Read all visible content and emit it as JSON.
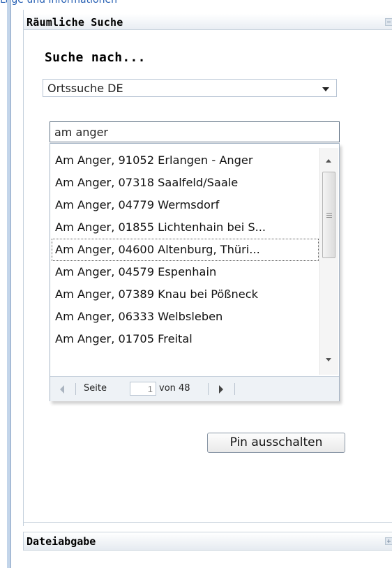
{
  "top_link": "Lage und Informationen",
  "spatial_panel": {
    "title": "Räumliche Suche",
    "search_heading": "Suche nach...",
    "search_type_selected": "Ortssuche DE",
    "search_query": "am anger",
    "results": [
      "Am Anger, 91052 Erlangen - Anger",
      "Am Anger, 07318 Saalfeld/Saale",
      "Am Anger, 04779 Wermsdorf",
      "Am Anger, 01855 Lichtenhain bei S...",
      "Am Anger, 04600 Altenburg, Thüri...",
      "Am Anger, 04579 Espenhain",
      "Am Anger, 07389 Knau bei Pößneck",
      "Am Anger, 06333 Welbsleben",
      "Am Anger, 01705 Freital"
    ],
    "selected_index": 4,
    "paging": {
      "page_label": "Seite",
      "current_page": "1",
      "of_label": "von 48"
    },
    "pin_button_label": "Pin ausschalten"
  },
  "file_panel": {
    "title": "Dateiabgabe"
  },
  "icons": {
    "collapse": "collapse-icon",
    "expand": "expand-icon",
    "dropdown": "chevron-down-icon",
    "prev_page": "prev-page-icon",
    "next_page": "next-page-icon",
    "scroll_up": "scroll-up-icon",
    "scroll_down": "scroll-down-icon"
  }
}
